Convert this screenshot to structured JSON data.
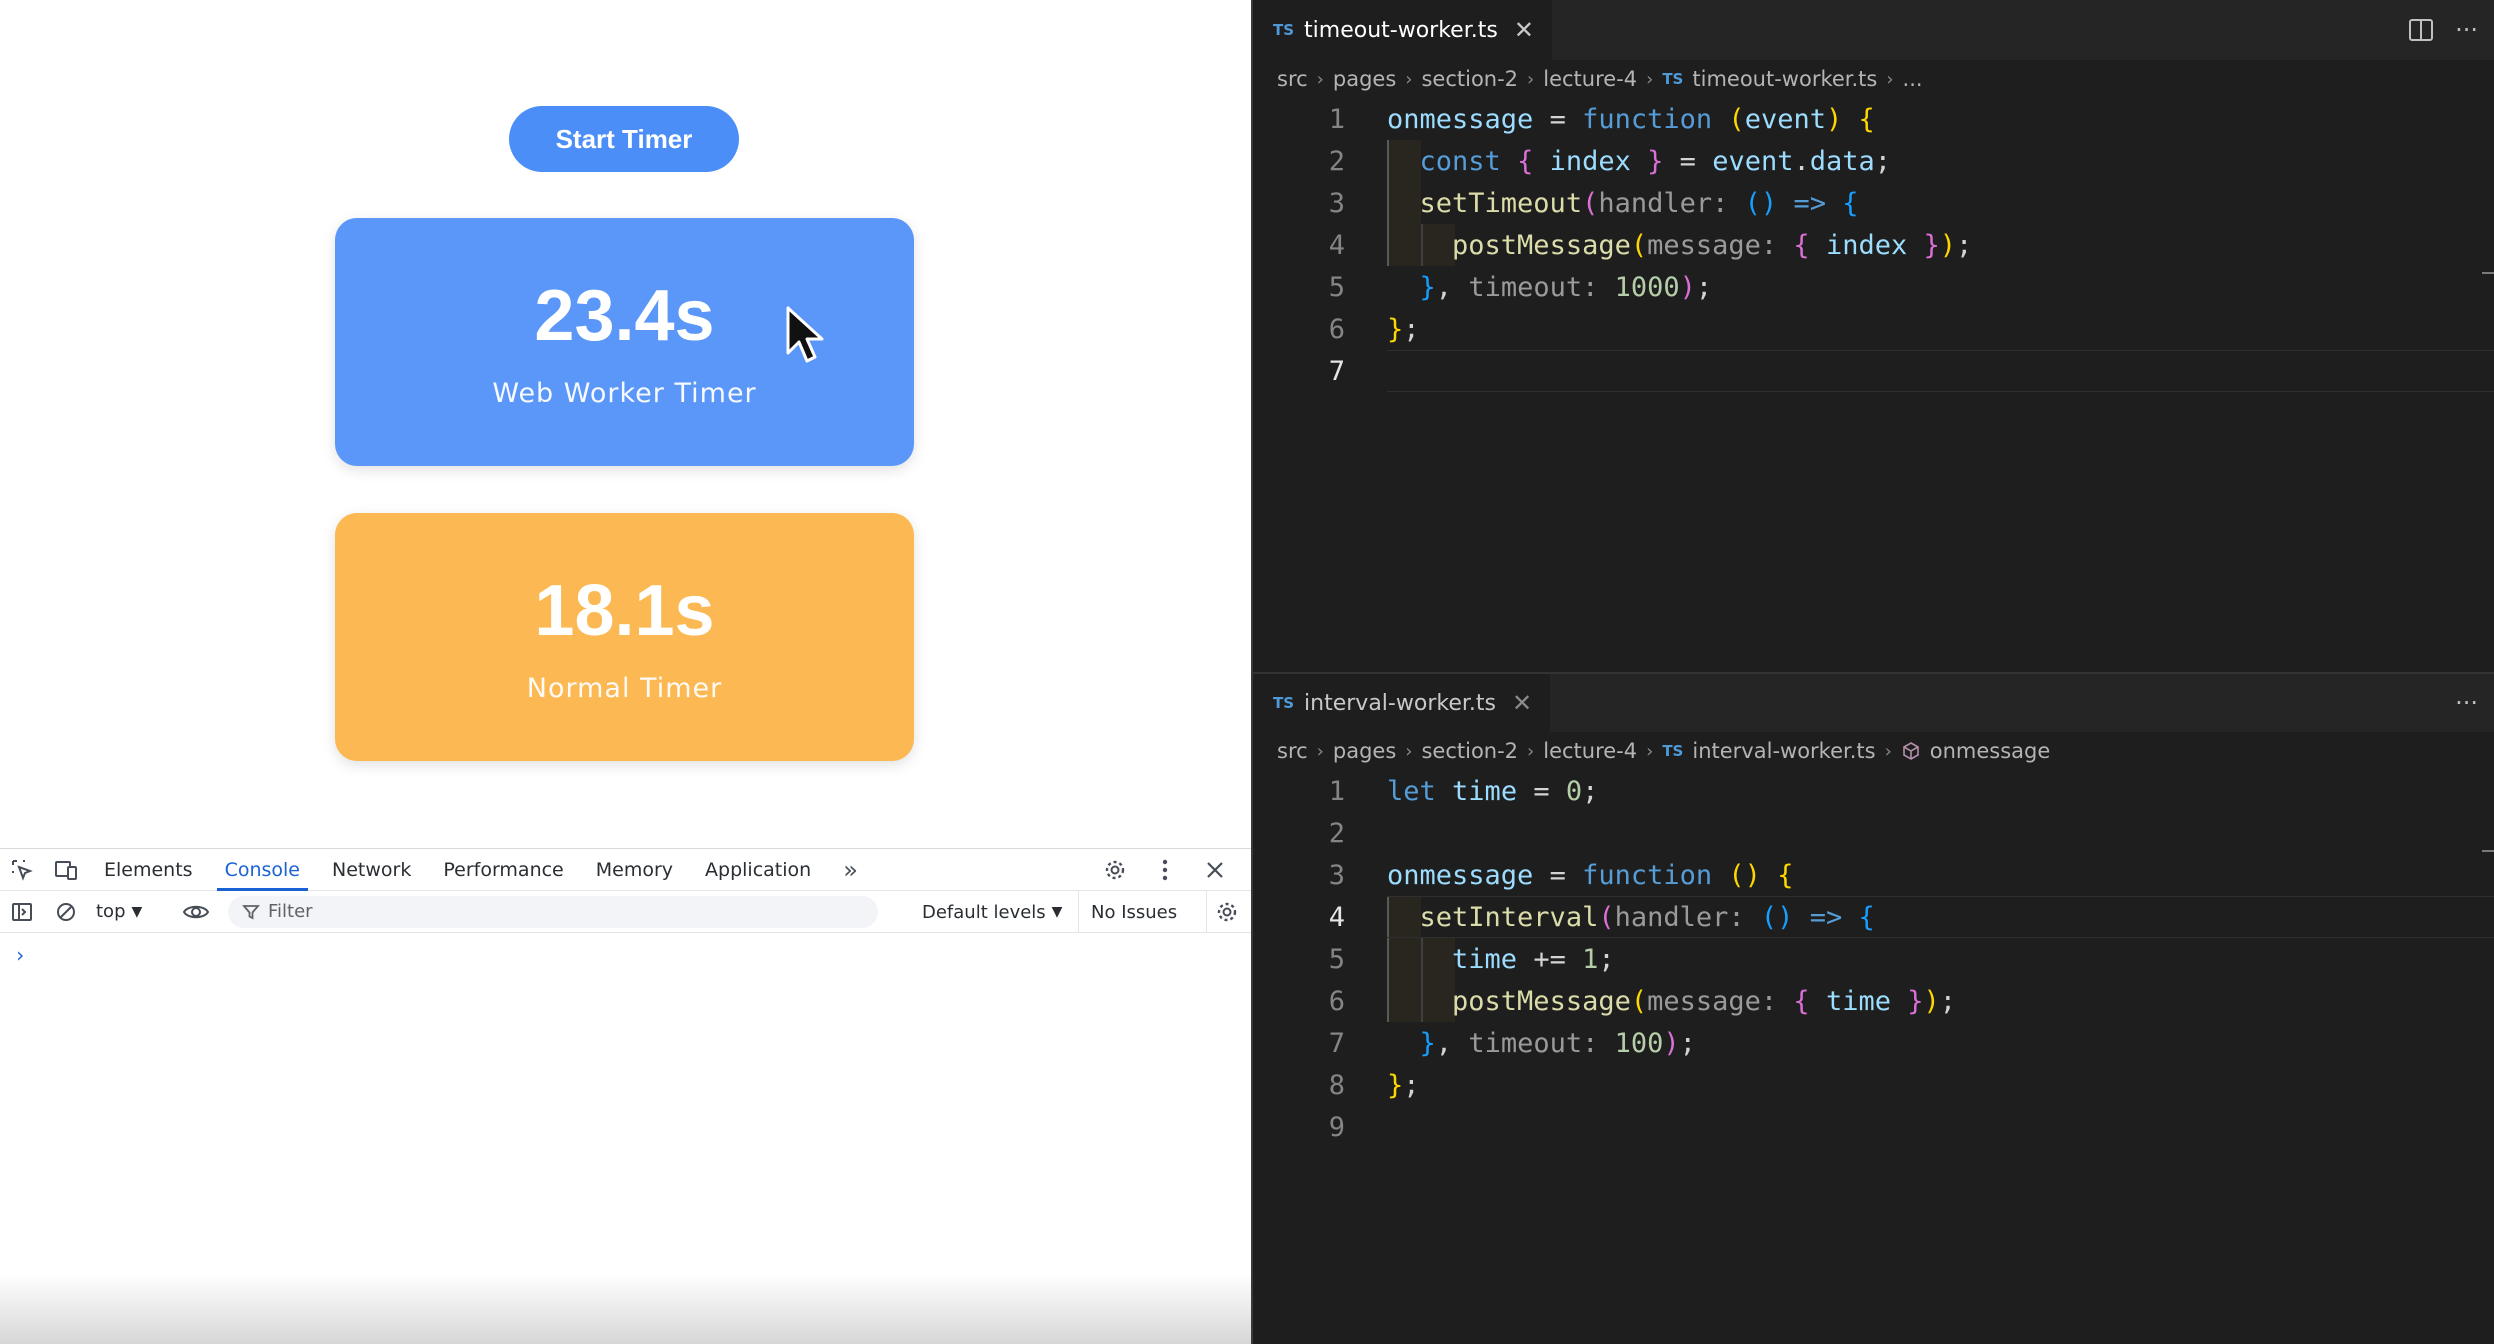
{
  "browser": {
    "start_button": "Start Timer",
    "worker_card": {
      "value": "23.4s",
      "label": "Web Worker Timer"
    },
    "normal_card": {
      "value": "18.1s",
      "label": "Normal Timer"
    }
  },
  "devtools": {
    "tabs": [
      "Elements",
      "Console",
      "Network",
      "Performance",
      "Memory",
      "Application"
    ],
    "active_tab": "Console",
    "more_tabs": "»",
    "context": "top",
    "filter_placeholder": "Filter",
    "levels": "Default levels",
    "issues": "No Issues",
    "prompt": "›"
  },
  "editor": {
    "top": {
      "tab": "timeout-worker.ts",
      "badge": "TS",
      "breadcrumb": [
        "src",
        "pages",
        "section-2",
        "lecture-4",
        "timeout-worker.ts",
        "..."
      ],
      "line_numbers": [
        "1",
        "2",
        "3",
        "4",
        "5",
        "6",
        "7"
      ]
    },
    "bottom": {
      "tab": "interval-worker.ts",
      "badge": "TS",
      "breadcrumb": [
        "src",
        "pages",
        "section-2",
        "lecture-4",
        "interval-worker.ts",
        "onmessage"
      ],
      "line_numbers": [
        "1",
        "2",
        "3",
        "4",
        "5",
        "6",
        "7",
        "8",
        "9"
      ]
    }
  },
  "colors": {
    "start_button": "#4c8ef7",
    "worker_card": "#5a97f8",
    "normal_card": "#fcb852",
    "editor_bg": "#1e1e1e"
  }
}
